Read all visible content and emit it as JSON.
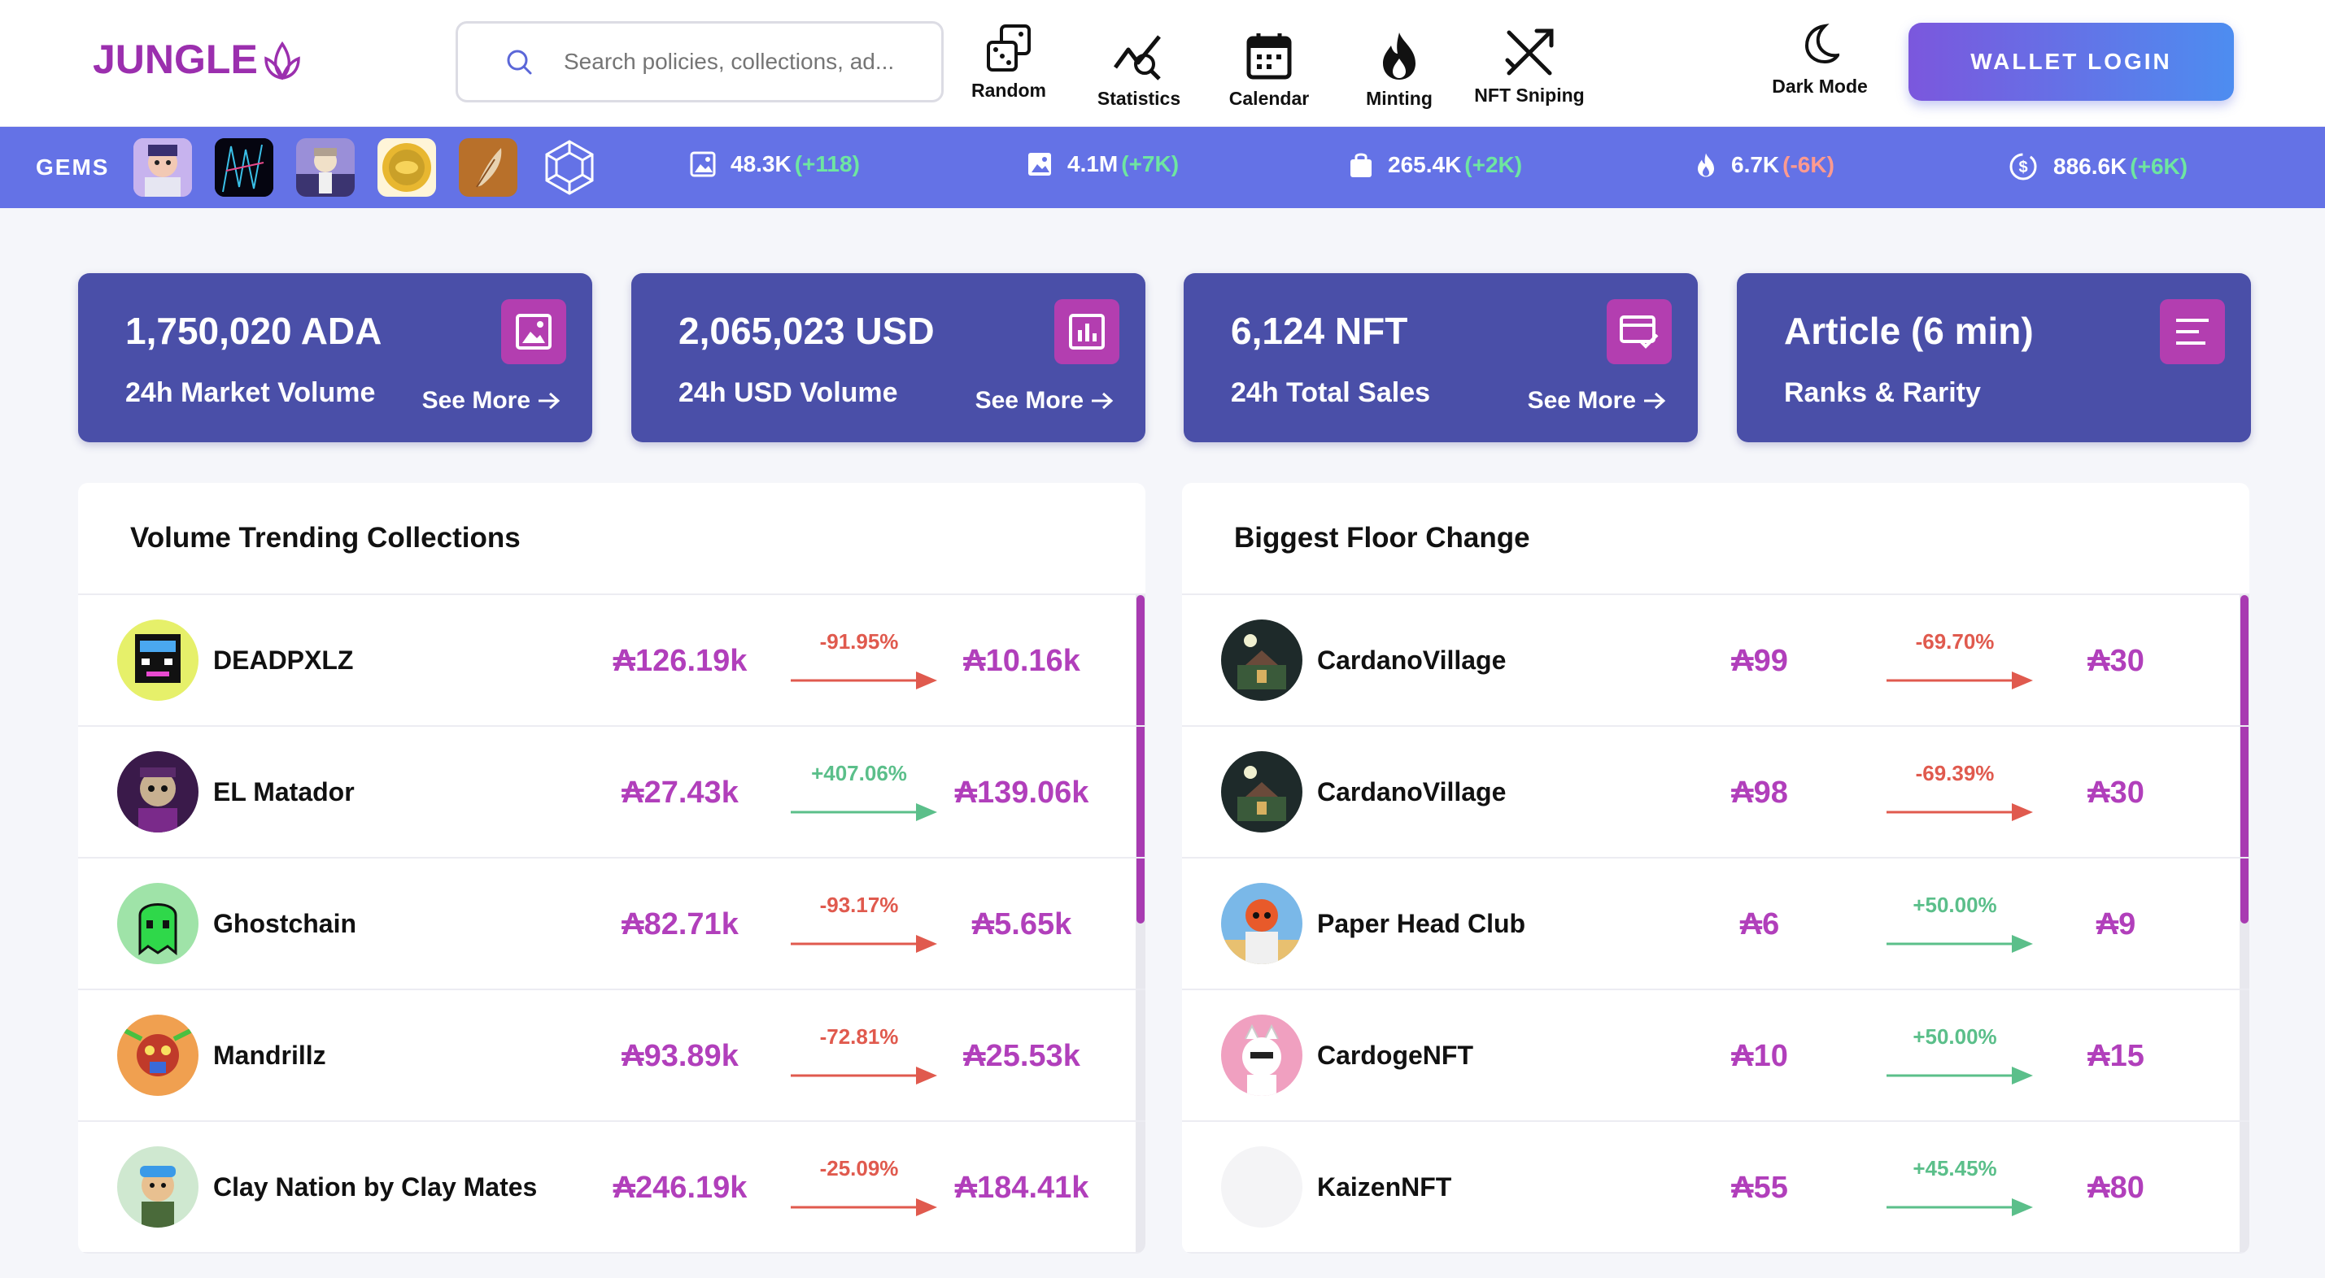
{
  "header": {
    "logo": "JUNGLE",
    "search_placeholder": "Search policies, collections, ad...",
    "nav": [
      {
        "label": "Random",
        "icon": "dice-icon"
      },
      {
        "label": "Statistics",
        "icon": "chart-line-icon"
      },
      {
        "label": "Calendar",
        "icon": "calendar-icon"
      },
      {
        "label": "Minting",
        "icon": "flame-icon"
      },
      {
        "label": "NFT Sniping",
        "icon": "sniping-icon"
      }
    ],
    "dark_mode": "Dark Mode",
    "wallet_login": "WALLET LOGIN"
  },
  "ticker": {
    "gems_label": "GEMS",
    "stats": [
      {
        "value": "48.3K",
        "change": "(+118)",
        "icon": "image-icon",
        "dir": "up"
      },
      {
        "value": "4.1M",
        "change": "(+7K)",
        "icon": "image-icon",
        "dir": "up"
      },
      {
        "value": "265.4K",
        "change": "(+2K)",
        "icon": "shopping-bag-icon",
        "dir": "up"
      },
      {
        "value": "6.7K",
        "change": "(-6K)",
        "icon": "flame-icon",
        "dir": "down"
      },
      {
        "value": "886.6K",
        "change": "(+6K)",
        "icon": "exchange-icon",
        "dir": "up"
      }
    ]
  },
  "cards": [
    {
      "big": "1,750,020 ADA",
      "sub": "24h Market Volume",
      "more": "See More",
      "icon": "image-icon"
    },
    {
      "big": "2,065,023 USD",
      "sub": "24h USD Volume",
      "more": "See More",
      "icon": "bar-chart-icon"
    },
    {
      "big": "6,124 NFT",
      "sub": "24h Total Sales",
      "more": "See More",
      "icon": "sales-icon"
    },
    {
      "big": "Article (6 min)",
      "sub": "Ranks & Rarity",
      "more": "",
      "icon": "menu-icon"
    }
  ],
  "volume_panel": {
    "title": "Volume Trending Collections",
    "rows": [
      {
        "name": "DEADPXLZ",
        "from": "₳126.19k",
        "pct": "-91.95%",
        "to": "₳10.16k",
        "dir": "down"
      },
      {
        "name": "EL Matador",
        "from": "₳27.43k",
        "pct": "+407.06%",
        "to": "₳139.06k",
        "dir": "up"
      },
      {
        "name": "Ghostchain",
        "from": "₳82.71k",
        "pct": "-93.17%",
        "to": "₳5.65k",
        "dir": "down"
      },
      {
        "name": "Mandrillz",
        "from": "₳93.89k",
        "pct": "-72.81%",
        "to": "₳25.53k",
        "dir": "down"
      },
      {
        "name": "Clay Nation by Clay Mates",
        "from": "₳246.19k",
        "pct": "-25.09%",
        "to": "₳184.41k",
        "dir": "down"
      }
    ]
  },
  "floor_panel": {
    "title": "Biggest Floor Change",
    "rows": [
      {
        "name": "CardanoVillage",
        "from": "₳99",
        "pct": "-69.70%",
        "to": "₳30",
        "dir": "down"
      },
      {
        "name": "CardanoVillage",
        "from": "₳98",
        "pct": "-69.39%",
        "to": "₳30",
        "dir": "down"
      },
      {
        "name": "Paper Head Club",
        "from": "₳6",
        "pct": "+50.00%",
        "to": "₳9",
        "dir": "up"
      },
      {
        "name": "CardogeNFT",
        "from": "₳10",
        "pct": "+50.00%",
        "to": "₳15",
        "dir": "up"
      },
      {
        "name": "KaizenNFT",
        "from": "₳55",
        "pct": "+45.45%",
        "to": "₳80",
        "dir": "up"
      }
    ]
  },
  "colors": {
    "accent": "#b13fbb",
    "card": "#4a4fa8",
    "ticker": "#6472e6",
    "down": "#e05a4e",
    "up": "#5bbf8a"
  }
}
